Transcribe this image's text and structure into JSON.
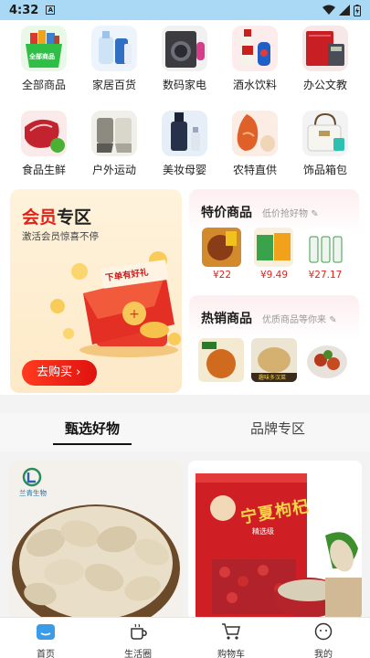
{
  "status_bar": {
    "time": "4:32",
    "notif_badge": "A"
  },
  "categories": [
    {
      "label": "全部商品",
      "icon": "all-products-icon"
    },
    {
      "label": "家居百货",
      "icon": "home-goods-icon"
    },
    {
      "label": "数码家电",
      "icon": "digital-appliances-icon"
    },
    {
      "label": "酒水饮料",
      "icon": "drinks-icon"
    },
    {
      "label": "办公文教",
      "icon": "office-supplies-icon"
    },
    {
      "label": "食品生鲜",
      "icon": "fresh-food-icon"
    },
    {
      "label": "户外运动",
      "icon": "outdoor-sports-icon"
    },
    {
      "label": "美妆母婴",
      "icon": "beauty-baby-icon"
    },
    {
      "label": "农特直供",
      "icon": "farm-products-icon"
    },
    {
      "label": "饰品箱包",
      "icon": "accessories-bags-icon"
    }
  ],
  "all_products_badge": "全部商品",
  "vip": {
    "title_red": "会员",
    "title_dark": "专区",
    "subtitle": "激活会员惊喜不停",
    "envelope_text": "下单有好礼",
    "button": "去购买"
  },
  "special": {
    "title": "特价商品",
    "subtitle": "低价抢好物",
    "prices": [
      "¥22",
      "¥9.49",
      "¥27.17"
    ]
  },
  "hot": {
    "title": "热销商品",
    "subtitle": "优质商品等你来",
    "thumb_caption": "趣味多汉菜"
  },
  "tabs": {
    "selected": "甄选好物",
    "brand": "品牌专区"
  },
  "products": [
    {
      "brand_label": "兰青生物"
    },
    {
      "package_text": "宁夏枸杞",
      "package_sub": "精选级"
    }
  ],
  "bottom_nav": [
    {
      "label": "首页",
      "icon": "home-icon"
    },
    {
      "label": "生活圈",
      "icon": "life-circle-icon"
    },
    {
      "label": "购物车",
      "icon": "cart-icon"
    },
    {
      "label": "我的",
      "icon": "profile-icon"
    }
  ],
  "colors": {
    "accent_red": "#e2231a",
    "status_bar": "#a9d9f5",
    "active_nav": "#3a9be8"
  }
}
